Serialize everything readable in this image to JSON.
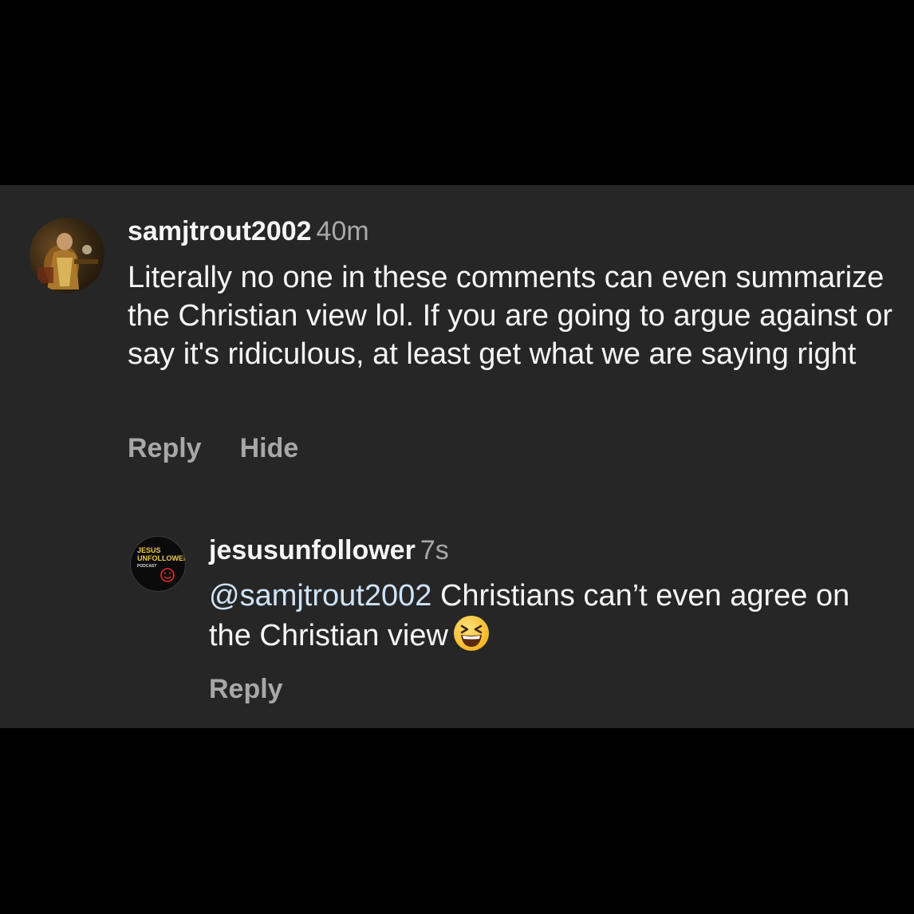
{
  "comments": [
    {
      "username": "samjtrout2002",
      "time": "40m",
      "avatar_icon": "painting-avatar-icon",
      "text": "Literally no one in these comments can even summarize the Christian view lol. If you are going to argue against or say it's ridiculous, at least get what we are saying right",
      "actions": [
        "Reply",
        "Hide"
      ]
    },
    {
      "username": "jesusunfollower",
      "time": "7s",
      "avatar_icon": "podcast-logo-avatar-icon",
      "avatar_logo_text": [
        "JESUS",
        "UNFOLLOWER",
        "PODCAST"
      ],
      "mention": "@samjtrout2002",
      "text": " Christians can’t even agree on the Christian view",
      "emoji_icon": "grinning-squinting-face-icon",
      "actions": [
        "Reply"
      ]
    }
  ],
  "colors": {
    "background": "#000000",
    "panel": "#262626",
    "primary_text": "#f5f5f5",
    "secondary_text": "#a8a8a8",
    "mention": "#cfe3f7"
  }
}
